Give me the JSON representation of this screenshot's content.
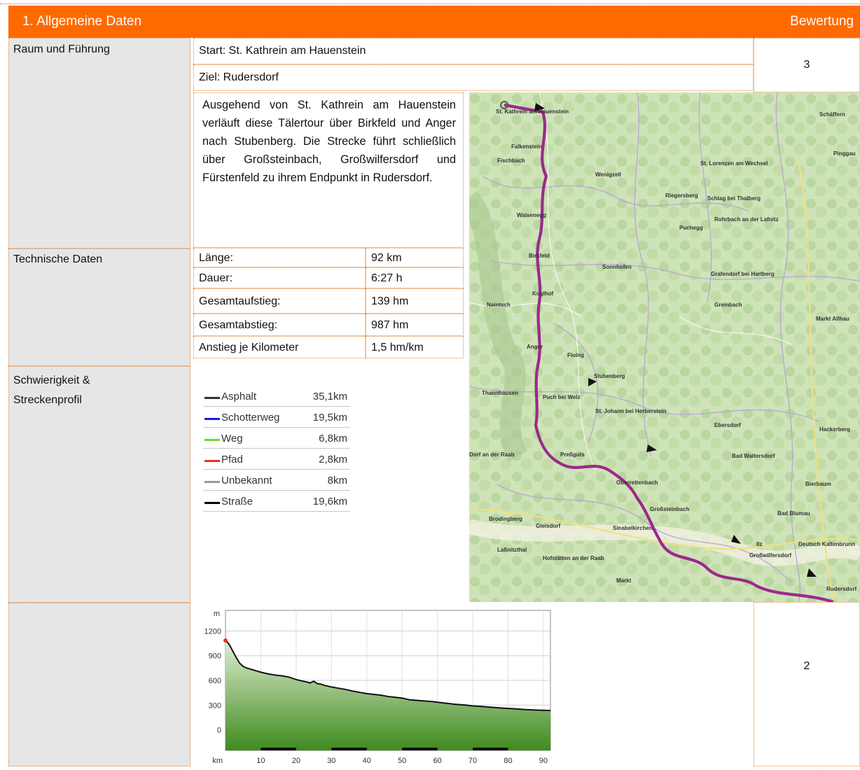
{
  "header": {
    "title": "1. Allgemeine Daten",
    "rating_label": "Bewertung"
  },
  "raum": {
    "label": "Raum und Führung",
    "start": "Start: St. Kathrein am Hauenstein",
    "ziel": "Ziel: Rudersdorf",
    "rating": "3",
    "description": "Ausgehend von St. Kathrein am Hauenstein verläuft diese Tälertour über Birkfeld und Anger nach Stubenberg. Die Strecke führt schließlich über Großsteinbach, Großwilfersdorf und Fürstenfeld zu ihrem Endpunkt in Rudersdorf."
  },
  "technische": {
    "label": "Technische Daten",
    "rows": [
      {
        "key": "Länge:",
        "value": "92 km"
      },
      {
        "key": "Dauer:",
        "value": "6:27 h"
      },
      {
        "key": "Gesamtaufstieg:",
        "value": "139 hm"
      },
      {
        "key": "Gesamtabstieg:",
        "value": "987 hm"
      },
      {
        "key": "Anstieg je Kilometer",
        "value": "1,5 hm/km"
      }
    ]
  },
  "schwierigkeit": {
    "label_line1": "Schwierigkeit &",
    "label_line2": "Streckenprofil",
    "rating": "2",
    "legend": [
      {
        "name": "Asphalt",
        "value": "35,1km",
        "color": "#333333"
      },
      {
        "name": "Schotterweg",
        "value": "19,5km",
        "color": "#1a1ae6"
      },
      {
        "name": "Weg",
        "value": "6,8km",
        "color": "#66dd33"
      },
      {
        "name": "Pfad",
        "value": "2,8km",
        "color": "#e63322"
      },
      {
        "name": "Unbekannt",
        "value": "8km",
        "color": "#999999"
      },
      {
        "name": "Straße",
        "value": "19,6km",
        "color": "#000000"
      }
    ]
  },
  "map": {
    "labels": [
      "St. Kathrein am Hauenstein",
      "Fischbach",
      "Falkenstein",
      "Wenigzell",
      "St. Lorenzen am Wechsel",
      "Schäffern",
      "Pinggau",
      "Riegersberg",
      "Schlag bei Thalberg",
      "Waisenegg",
      "Puchegg",
      "Rohrbach an der Lafnitz",
      "Birkfeld",
      "Sonnhofen",
      "Grafendorf bei Hartberg",
      "Naintsch",
      "Koglhof",
      "Greinbach",
      "Markt Allhau",
      "Anger",
      "Floing",
      "Stubenberg",
      "Thannhausen",
      "Puch bei Weiz",
      "St. Johann bei Herberstein",
      "Ebersdorf",
      "Hackerberg",
      "Dorf an der Raab",
      "Preßguts",
      "Bad Waltersdorf",
      "Oberrettenbach",
      "Bierbaum",
      "Brodingberg",
      "Gleisdorf",
      "Sinabelkirchen",
      "Bad Blumau",
      "Großsteinbach",
      "Ilz",
      "Großwilfersdorf",
      "Deutsch Kaltenbrunn",
      "Hofstätten an der Raab",
      "Laßnitzthal",
      "Rudersdorf",
      "Markt"
    ]
  },
  "chart_data": {
    "type": "area",
    "xlabel": "km",
    "ylabel": "m",
    "xticks": [
      10,
      20,
      30,
      40,
      50,
      60,
      70,
      80,
      90
    ],
    "yticks": [
      0,
      300,
      600,
      900,
      1200
    ],
    "xlim": [
      0,
      92
    ],
    "ylim": [
      -250,
      1450
    ],
    "x": [
      0,
      1,
      2,
      3,
      4,
      5,
      6,
      8,
      10,
      12,
      14,
      16,
      18,
      20,
      22,
      24,
      25,
      26,
      27,
      28,
      30,
      32,
      34,
      36,
      38,
      40,
      42,
      44,
      46,
      48,
      50,
      52,
      55,
      58,
      60,
      62,
      65,
      68,
      70,
      72,
      75,
      78,
      80,
      82,
      85,
      88,
      92
    ],
    "y": [
      1085,
      1040,
      960,
      880,
      810,
      770,
      750,
      725,
      700,
      680,
      665,
      655,
      640,
      610,
      590,
      570,
      590,
      560,
      555,
      540,
      520,
      505,
      490,
      470,
      455,
      440,
      430,
      420,
      405,
      395,
      385,
      365,
      355,
      345,
      335,
      325,
      310,
      300,
      290,
      285,
      275,
      265,
      260,
      255,
      245,
      240,
      235
    ]
  }
}
